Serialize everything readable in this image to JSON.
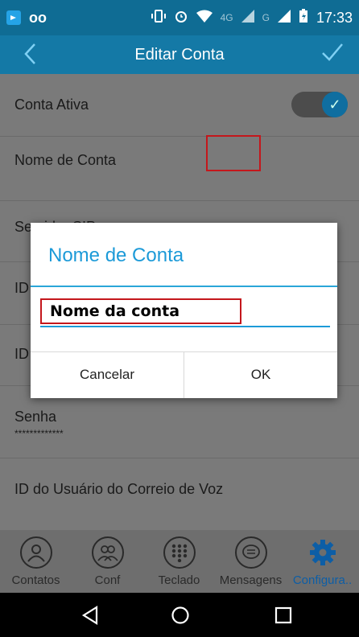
{
  "status": {
    "signal_4g": "4G",
    "signal_g": "G",
    "time": "17:33"
  },
  "appbar": {
    "title": "Editar Conta"
  },
  "settings": {
    "conta_ativa": "Conta Ativa",
    "nome_conta": "Nome de Conta",
    "servidor": "Servidor SIP",
    "id1": "ID",
    "id2": "ID",
    "senha": "Senha",
    "senha_val": "*************",
    "voicemail": "ID do Usuário do Correio de Voz"
  },
  "dialog": {
    "title": "Nome de Conta",
    "input_value": "Nome da conta",
    "cancel": "Cancelar",
    "ok": "OK"
  },
  "tabs": [
    {
      "label": "Contatos",
      "icon": "contacts-icon"
    },
    {
      "label": "Conf",
      "icon": "conference-icon"
    },
    {
      "label": "Teclado",
      "icon": "keypad-icon"
    },
    {
      "label": "Mensagens",
      "icon": "messages-icon"
    },
    {
      "label": "Configura..",
      "icon": "gear-icon"
    }
  ],
  "colors": {
    "statusbar": "#0f6c94",
    "appbar": "#1479a6",
    "accent": "#1c9ad8",
    "highlight": "#c4171c"
  }
}
